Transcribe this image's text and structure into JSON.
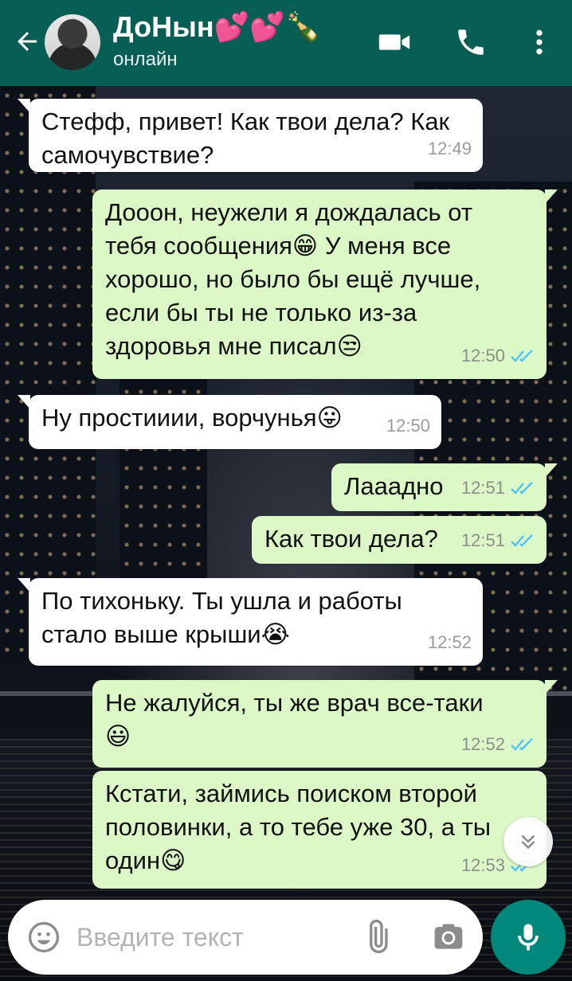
{
  "header": {
    "contact_name": "ДоНын💕💕🍾",
    "status": "онлайн"
  },
  "icons": {
    "back": "arrow-left-icon",
    "video": "video-camera-icon",
    "call": "phone-icon",
    "menu": "more-vertical-icon",
    "emoji": "emoji-icon",
    "attach": "paperclip-icon",
    "camera": "camera-icon",
    "mic": "microphone-icon",
    "scroll_down": "double-chevron-down-icon"
  },
  "colors": {
    "header": "#075e54",
    "outgoing_bubble": "#dcf8c6",
    "incoming_bubble": "#ffffff",
    "read_ticks": "#4fc3f7",
    "mic_button": "#00897b"
  },
  "messages": [
    {
      "direction": "in",
      "text": "Стефф, привет! Как твои дела? Как\nсамочувствие?",
      "time": "12:49"
    },
    {
      "direction": "out",
      "text": "Дооон, неужели я дождалась от\nтебя сообщения😁 У меня все\nхорошо, но было бы ещё лучше,\nесли бы ты не только из-за\nздоровья мне писал😒",
      "time": "12:50",
      "status": "read"
    },
    {
      "direction": "in",
      "text": "Ну простииии, ворчунья😛",
      "time": "12:50"
    },
    {
      "direction": "out",
      "text": "Лааадно",
      "time": "12:51",
      "status": "read"
    },
    {
      "direction": "out",
      "text": "Как твои дела?",
      "time": "12:51",
      "status": "read"
    },
    {
      "direction": "in",
      "text": "По тихоньку. Ты ушла и работы\nстало выше крыши😭",
      "time": "12:52"
    },
    {
      "direction": "out",
      "text": "Не жалуйся, ты же врач все-таки\n😃",
      "time": "12:52",
      "status": "read"
    },
    {
      "direction": "out",
      "text": "Кстати, займись поиском второй\nполовинки, а то тебе уже 30, а ты\nодин😋",
      "time": "12:53",
      "status": "read"
    }
  ],
  "composer": {
    "placeholder": "Введите текст",
    "value": ""
  }
}
